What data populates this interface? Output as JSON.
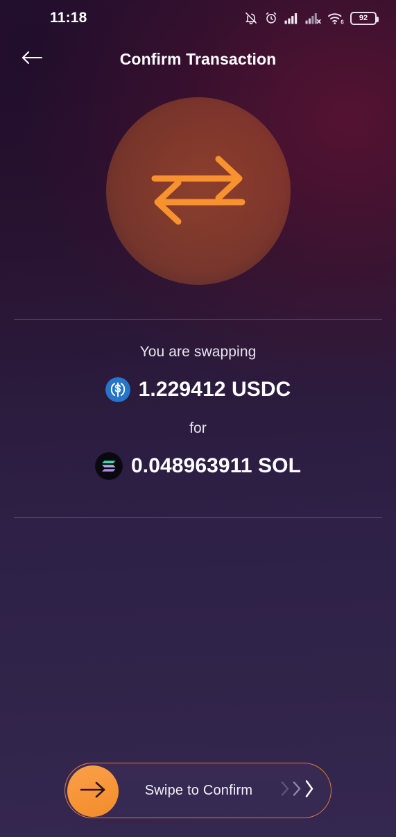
{
  "status_bar": {
    "time": "11:18",
    "battery_percent": "92",
    "icons": [
      "notifications-muted-icon",
      "alarm-clock-icon",
      "signal-bars-icon",
      "signal-no-service-icon",
      "wifi-6-icon",
      "battery-icon"
    ]
  },
  "header": {
    "back_icon": "arrow-left-icon",
    "title": "Confirm Transaction"
  },
  "hero": {
    "icon": "swap-arrows-icon",
    "accent_color": "#f7922e",
    "circle_color": "#b85828"
  },
  "swap": {
    "from_label": "You are swapping",
    "from_amount": "1.229412 USDC",
    "from_token_icon": "usdc-coin-icon",
    "from_token_color": "#2775ca",
    "connector_label": "for",
    "to_amount": "0.048963911 SOL",
    "to_token_icon": "solana-coin-icon",
    "to_token_colors": [
      "#14f195",
      "#9945ff"
    ]
  },
  "swipe_button": {
    "label": "Swipe to Confirm",
    "thumb_icon": "arrow-right-icon",
    "chevron_icon": "chevron-right-icon",
    "border_color": "#e07b3a",
    "thumb_color": "#f79639"
  }
}
